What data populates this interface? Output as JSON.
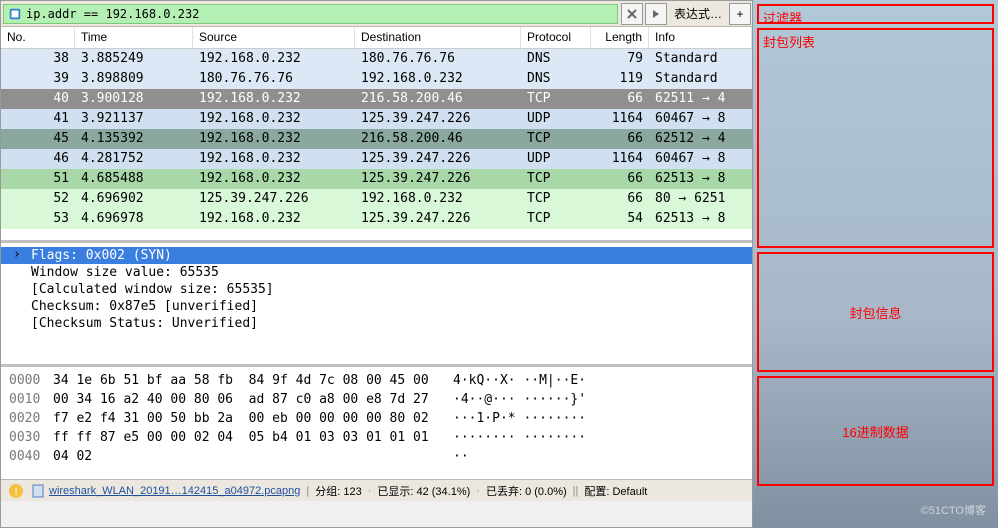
{
  "filter": {
    "expression": "ip.addr == 192.168.0.232",
    "expressionLabel": "表达式…",
    "plus": "+"
  },
  "columns": {
    "no": "No.",
    "time": "Time",
    "source": "Source",
    "destination": "Destination",
    "protocol": "Protocol",
    "length": "Length",
    "info": "Info"
  },
  "packets": [
    {
      "no": "38",
      "time": "3.885249",
      "src": "192.168.0.232",
      "dst": "180.76.76.76",
      "proto": "DNS",
      "len": "79",
      "info": "Standard",
      "cls": "row-dns"
    },
    {
      "no": "39",
      "time": "3.898809",
      "src": "180.76.76.76",
      "dst": "192.168.0.232",
      "proto": "DNS",
      "len": "119",
      "info": "Standard",
      "cls": "row-dns"
    },
    {
      "no": "40",
      "time": "3.900128",
      "src": "192.168.0.232",
      "dst": "216.58.200.46",
      "proto": "TCP",
      "len": "66",
      "info": "62511 → 4",
      "cls": "row-tcp-sel"
    },
    {
      "no": "41",
      "time": "3.921137",
      "src": "192.168.0.232",
      "dst": "125.39.247.226",
      "proto": "UDP",
      "len": "1164",
      "info": "60467 → 8",
      "cls": "row-udp"
    },
    {
      "no": "45",
      "time": "4.135392",
      "src": "192.168.0.232",
      "dst": "216.58.200.46",
      "proto": "TCP",
      "len": "66",
      "info": "62512 → 4",
      "cls": "row-tcp-hl"
    },
    {
      "no": "46",
      "time": "4.281752",
      "src": "192.168.0.232",
      "dst": "125.39.247.226",
      "proto": "UDP",
      "len": "1164",
      "info": "60467 → 8",
      "cls": "row-udp"
    },
    {
      "no": "51",
      "time": "4.685488",
      "src": "192.168.0.232",
      "dst": "125.39.247.226",
      "proto": "TCP",
      "len": "66",
      "info": "62513 → 8",
      "cls": "row-tcp-syn"
    },
    {
      "no": "52",
      "time": "4.696902",
      "src": "125.39.247.226",
      "dst": "192.168.0.232",
      "proto": "TCP",
      "len": "66",
      "info": "80 → 6251",
      "cls": "row-tcp-light"
    },
    {
      "no": "53",
      "time": "4.696978",
      "src": "192.168.0.232",
      "dst": "125.39.247.226",
      "proto": "TCP",
      "len": "54",
      "info": "62513 → 8",
      "cls": "row-tcp-light"
    }
  ],
  "details": [
    {
      "text": "Flags: 0x002 (SYN)",
      "selected": true
    },
    {
      "text": "Window size value: 65535"
    },
    {
      "text": "[Calculated window size: 65535]"
    },
    {
      "text": "Checksum: 0x87e5 [unverified]"
    },
    {
      "text": "[Checksum Status: Unverified]"
    }
  ],
  "hex": [
    {
      "off": "0000",
      "bytes": "34 1e 6b 51 bf aa 58 fb  84 9f 4d 7c 08 00 45 00",
      "ascii": "4·kQ··X· ··M|··E·"
    },
    {
      "off": "0010",
      "bytes": "00 34 16 a2 40 00 80 06  ad 87 c0 a8 00 e8 7d 27",
      "ascii": "·4··@··· ······}'"
    },
    {
      "off": "0020",
      "bytes": "f7 e2 f4 31 00 50 bb 2a  00 eb 00 00 00 00 80 02",
      "ascii": "···1·P·* ········"
    },
    {
      "off": "0030",
      "bytes": "ff ff 87 e5 00 00 02 04  05 b4 01 03 03 01 01 01",
      "ascii": "········ ········"
    },
    {
      "off": "0040",
      "bytes": "04 02                                           ",
      "ascii": "··"
    }
  ],
  "status": {
    "file": "wireshark_WLAN_20191…142415_a04972.pcapng",
    "packets": "分组: 123",
    "displayed": "已显示: 42 (34.1%)",
    "dropped": "已丢弃: 0 (0.0%)",
    "profile": "配置: Default"
  },
  "annotations": {
    "filter": "过滤器",
    "list": "封包列表",
    "info": "封包信息",
    "hex": "16进制数据"
  },
  "watermark": "©51CTO博客"
}
